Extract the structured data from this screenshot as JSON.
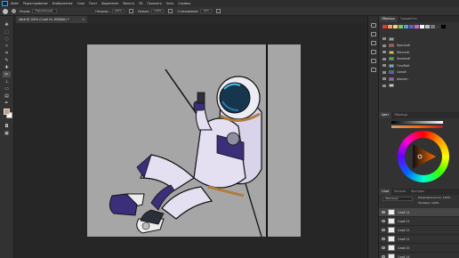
{
  "menubar": {
    "items": [
      "Файл",
      "Редактирование",
      "Изображение",
      "Слои",
      "Текст",
      "Выделение",
      "Фильтр",
      "3D",
      "Просмотр",
      "Окно",
      "Справка"
    ]
  },
  "options": {
    "mode_label": "Режим:",
    "mode_value": "Нормальный",
    "opacity_label": "Непрозр.:",
    "opacity_value": "100%",
    "flow_label": "Нажим:",
    "flow_value": "100%",
    "smoothing_label": "Сглаживание:",
    "smoothing_value": "10%"
  },
  "document": {
    "tab_title": "обуй @ 100% (Слой 24, RGB/8#) *"
  },
  "panels": {
    "swatch_tabs": [
      "Образцы",
      "Градиенты"
    ],
    "swatch_colors": [
      "#e53935",
      "#f4a261",
      "#f6d36b",
      "#7cc36b",
      "#4aa3df",
      "#6a5acd",
      "#c86ac8",
      "#ffffff",
      "#bdbdbd",
      "#7a7a7a",
      "#3a3a3a",
      "#000000"
    ],
    "groups": [
      {
        "label": "",
        "color": "#9e9e9e"
      },
      {
        "label": "Красный",
        "color": "#c84848"
      },
      {
        "label": "Желтый",
        "color": "#d9c94a"
      },
      {
        "label": "Зеленый",
        "color": "#4fae5a"
      },
      {
        "label": "Голубой",
        "color": "#5ab3d8"
      },
      {
        "label": "Синий",
        "color": "#4a5fc8"
      },
      {
        "label": "Фиолет.",
        "color": "#a45ac8"
      },
      {
        "label": "",
        "color": "#d0d0d0"
      }
    ],
    "color_tabs": [
      "Цвет",
      "Образцы"
    ],
    "layers_tabs": [
      "Слои",
      "Каналы",
      "Контуры"
    ],
    "blend_mode": "Обычные",
    "opacity_label": "Непрозрачность:",
    "opacity_value": "100%",
    "fill_label": "Заливка:",
    "fill_value": "100%",
    "layers": [
      {
        "name": "Слой 24",
        "selected": true
      },
      {
        "name": "Слой 23",
        "selected": false
      },
      {
        "name": "Слой 22",
        "selected": false
      },
      {
        "name": "Слой 21",
        "selected": false
      },
      {
        "name": "Слой 20",
        "selected": false
      },
      {
        "name": "Слой 19",
        "selected": false
      }
    ]
  },
  "colors": {
    "accent": "#2fa3f7",
    "foreground": "#c7a07c",
    "background": "#ffffff",
    "canvas_bg": "#a6a6a6"
  }
}
